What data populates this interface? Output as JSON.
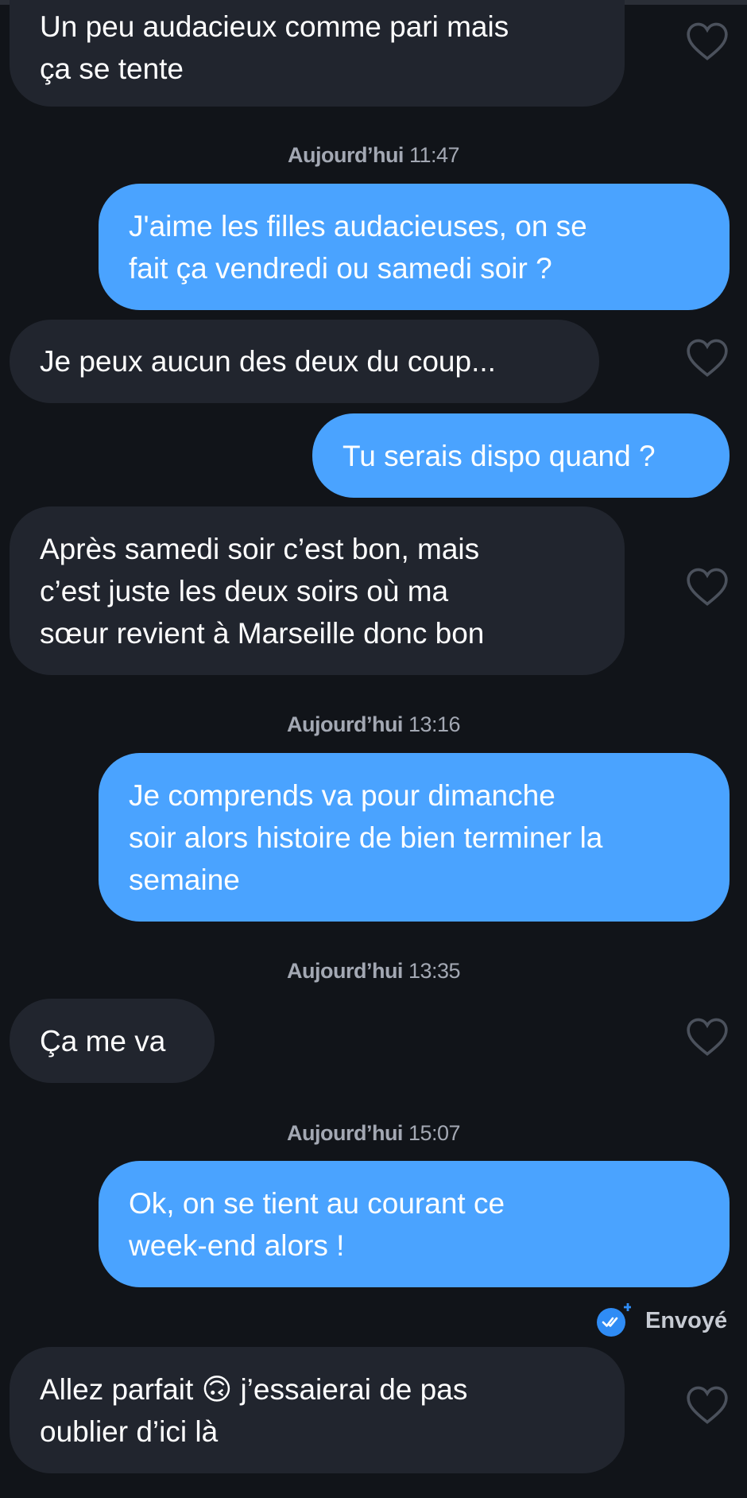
{
  "messages": [
    {
      "text": "Un peu audacieux comme pari mais\nça se tente"
    },
    {
      "text": "J'aime les filles audacieuses, on se\nfait ça vendredi ou samedi soir ?"
    },
    {
      "text": "Je peux aucun des deux du coup..."
    },
    {
      "text": "Tu serais dispo quand ?"
    },
    {
      "text": "Après samedi soir c’est bon, mais\nc’est juste les deux soirs où ma\nsœur revient à Marseille donc bon"
    },
    {
      "text": "Je comprends va pour dimanche\nsoir alors histoire de bien terminer la\nsemaine"
    },
    {
      "text": "Ça me va"
    },
    {
      "text": "Ok, on se tient au courant ce\nweek-end alors !"
    },
    {
      "text": "Allez parfait 🙃 j’essaierai de pas\noublier d’ici là"
    }
  ],
  "timestamps": [
    {
      "day": "Aujourd’hui",
      "time": "11:47"
    },
    {
      "day": "Aujourd’hui",
      "time": "13:16"
    },
    {
      "day": "Aujourd’hui",
      "time": "13:35"
    },
    {
      "day": "Aujourd’hui",
      "time": "15:07"
    }
  ],
  "status": {
    "label": "Envoyé",
    "icon": "read-receipt-check-icon"
  },
  "colors": {
    "background": "#111419",
    "received_bubble": "#21252e",
    "sent_bubble": "#4aa3ff",
    "timestamp_text": "#a3a8b3"
  }
}
